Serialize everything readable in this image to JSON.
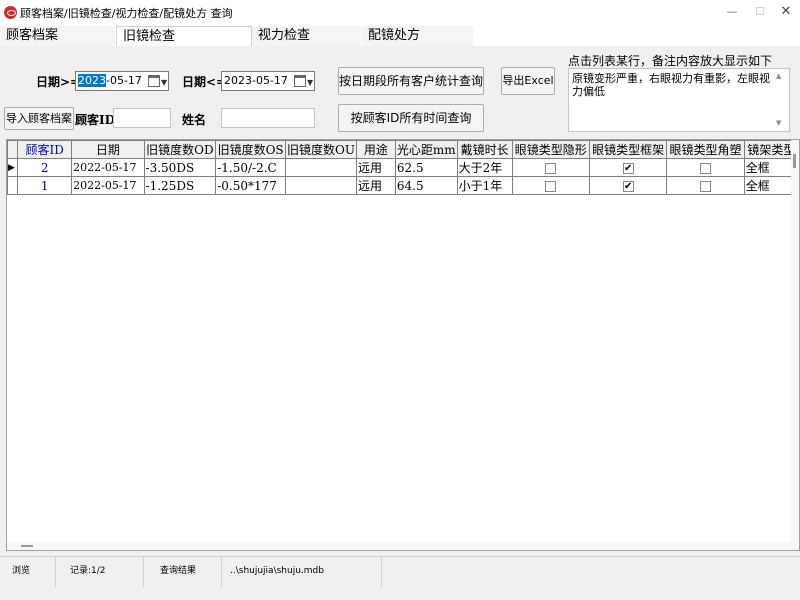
{
  "window": {
    "title": "顾客档案/旧镜检查/视力检查/配镜处方 查询",
    "minimize": "—",
    "maximize": "☐",
    "close": "✕"
  },
  "tabs": [
    {
      "label": "顾客档案",
      "active": false
    },
    {
      "label": "旧镜检查",
      "active": true
    },
    {
      "label": "视力检查",
      "active": false
    },
    {
      "label": "配镜处方",
      "active": false
    }
  ],
  "filters": {
    "date_from_label": "日期>=",
    "date_from_sel": "2023",
    "date_from_rest": "-05-17",
    "date_to_label": "日期<=",
    "date_to": "2023-05-17",
    "customer_id_label": "顾客ID",
    "customer_id": "",
    "name_label": "姓名",
    "name": ""
  },
  "buttons": {
    "query_by_date": "按日期段所有客户统计查询",
    "export_excel": "导出Excel",
    "import_customer": "导入顾客档案",
    "query_by_id": "按顾客ID所有时间查询"
  },
  "note": {
    "label": "点击列表某行，备注内容放大显示如下",
    "content": "原镜变形严重，右眼视力有重影，左眼视力偏低"
  },
  "grid": {
    "columns": [
      "顾客ID",
      "日期",
      "旧镜度数OD",
      "旧镜度数OS",
      "旧镜度数OU",
      "用途",
      "光心距mm",
      "戴镜时长",
      "眼镜类型隐形",
      "眼镜类型框架",
      "眼镜类型角塑",
      "镜架类型"
    ],
    "rows": [
      {
        "indicator": "▶",
        "id": "2",
        "date": "2022-05-17",
        "od": "-3.50DS",
        "os": "-1.50/-2.C",
        "ou": "",
        "use": "远用",
        "pd": "62.5",
        "wear": "大于2年",
        "t_contact": "",
        "t_frame": "✔",
        "t_ortho": "",
        "frame": "全框"
      },
      {
        "indicator": "",
        "id": "1",
        "date": "2022-05-17",
        "od": "-1.25DS",
        "os": "-0.50*177",
        "ou": "",
        "use": "远用",
        "pd": "64.5",
        "wear": "小于1年",
        "t_contact": "",
        "t_frame": "✔",
        "t_ortho": "",
        "frame": "全框"
      }
    ]
  },
  "status": {
    "mode": "浏览",
    "records": "记录:1/2",
    "result": "查询结果",
    "db_path": "..\\shujujia\\shuju.mdb"
  },
  "colors": {
    "accent": "#0078d7",
    "id_text": "#0000cc",
    "panel_bg": "#f0f0f0"
  },
  "icons": [
    "app-icon",
    "calendar-icon",
    "chevron-down-icon",
    "row-pointer-icon",
    "checkmark-icon"
  ]
}
